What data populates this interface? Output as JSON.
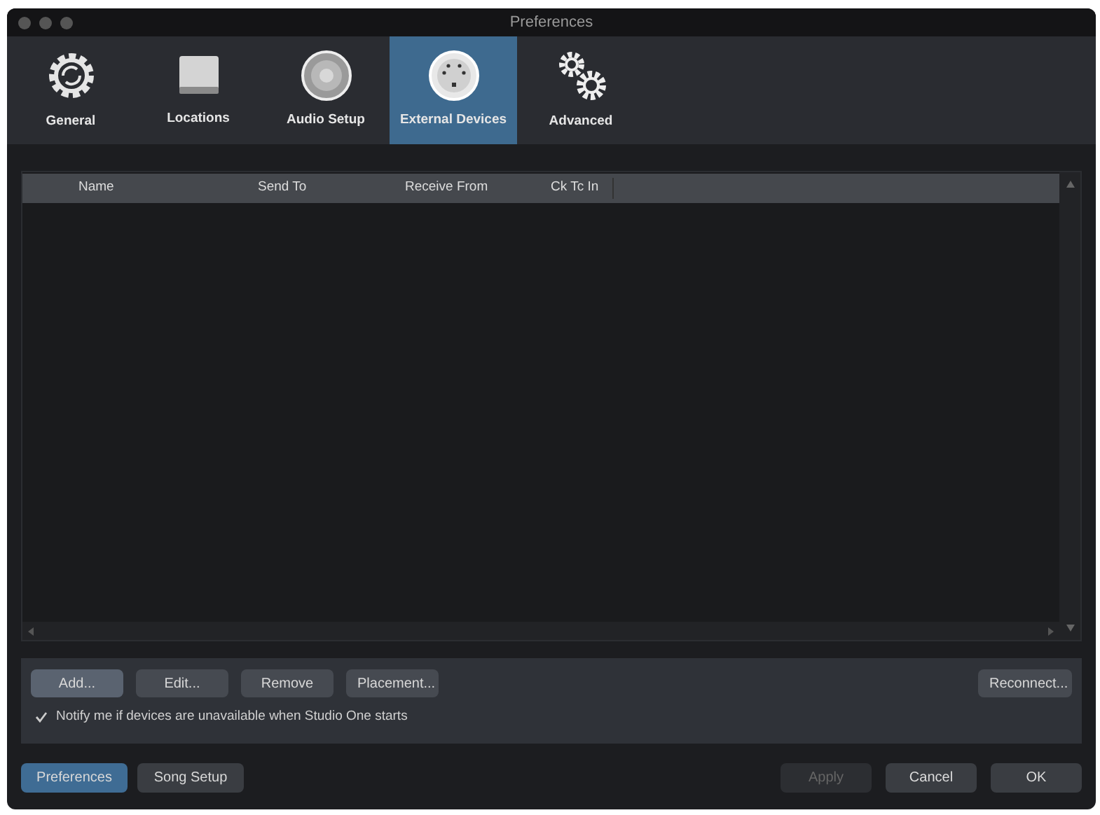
{
  "window": {
    "title": "Preferences"
  },
  "tabs": [
    {
      "kind": "general",
      "label": "General",
      "selected": false
    },
    {
      "kind": "locations",
      "label": "Locations",
      "selected": false
    },
    {
      "kind": "audio",
      "label": "Audio Setup",
      "selected": false
    },
    {
      "kind": "external",
      "label": "External Devices",
      "selected": true
    },
    {
      "kind": "advanced",
      "label": "Advanced",
      "selected": false
    }
  ],
  "table": {
    "columns": [
      "Name",
      "Send To",
      "Receive From",
      "Ck Tc In"
    ]
  },
  "device_buttons": [
    {
      "label": "Add...",
      "hovered": true
    },
    {
      "label": "Edit...",
      "hovered": false
    },
    {
      "label": "Remove",
      "hovered": false
    },
    {
      "label": "Placement...",
      "hovered": false
    }
  ],
  "reconnect_button": "Reconnect...",
  "notify_checkbox": {
    "label": "Notify me if devices are unavailable when Studio One starts",
    "checked": true
  },
  "footer_tabs": [
    {
      "label": "Preferences",
      "selected": true
    },
    {
      "label": "Song Setup",
      "selected": false
    }
  ],
  "dialog_buttons": [
    {
      "label": "Apply",
      "disabled": true
    },
    {
      "label": "Cancel",
      "disabled": false
    },
    {
      "label": "OK",
      "disabled": false
    }
  ]
}
